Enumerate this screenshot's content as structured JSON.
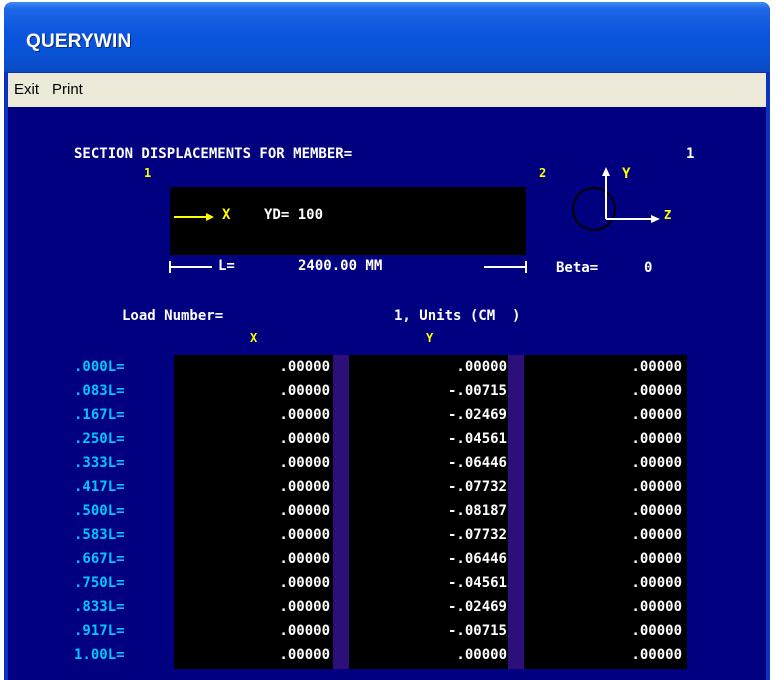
{
  "window": {
    "title": "QUERYWIN"
  },
  "menu": {
    "items": [
      "Exit",
      "Print"
    ]
  },
  "panel": {
    "header_label": "SECTION DISPLACEMENTS FOR MEMBER=",
    "member_number": "1",
    "start_node": "1",
    "end_node": "2",
    "beam_axis": "X",
    "yd_label": "YD= 100",
    "length_label": "L=",
    "length_value": "2400.00 MM",
    "beta_label": "Beta=",
    "beta_value": "0",
    "axis_y": "Y",
    "axis_z": "Z",
    "load_label": "Load Number=",
    "load_info": "1, Units (CM  )",
    "col_x": "X",
    "col_y": "Y"
  },
  "table": {
    "rows": [
      {
        "pos": ".000L=",
        "x": ".00000",
        "y": ".00000",
        "z": ".00000"
      },
      {
        "pos": ".083L=",
        "x": ".00000",
        "y": "-.00715",
        "z": ".00000"
      },
      {
        "pos": ".167L=",
        "x": ".00000",
        "y": "-.02469",
        "z": ".00000"
      },
      {
        "pos": ".250L=",
        "x": ".00000",
        "y": "-.04561",
        "z": ".00000"
      },
      {
        "pos": ".333L=",
        "x": ".00000",
        "y": "-.06446",
        "z": ".00000"
      },
      {
        "pos": ".417L=",
        "x": ".00000",
        "y": "-.07732",
        "z": ".00000"
      },
      {
        "pos": ".500L=",
        "x": ".00000",
        "y": "-.08187",
        "z": ".00000"
      },
      {
        "pos": ".583L=",
        "x": ".00000",
        "y": "-.07732",
        "z": ".00000"
      },
      {
        "pos": ".667L=",
        "x": ".00000",
        "y": "-.06446",
        "z": ".00000"
      },
      {
        "pos": ".750L=",
        "x": ".00000",
        "y": "-.04561",
        "z": ".00000"
      },
      {
        "pos": ".833L=",
        "x": ".00000",
        "y": "-.02469",
        "z": ".00000"
      },
      {
        "pos": ".917L=",
        "x": ".00000",
        "y": "-.00715",
        "z": ".00000"
      },
      {
        "pos": "1.00L=",
        "x": ".00000",
        "y": ".00000",
        "z": ".00000"
      }
    ]
  }
}
